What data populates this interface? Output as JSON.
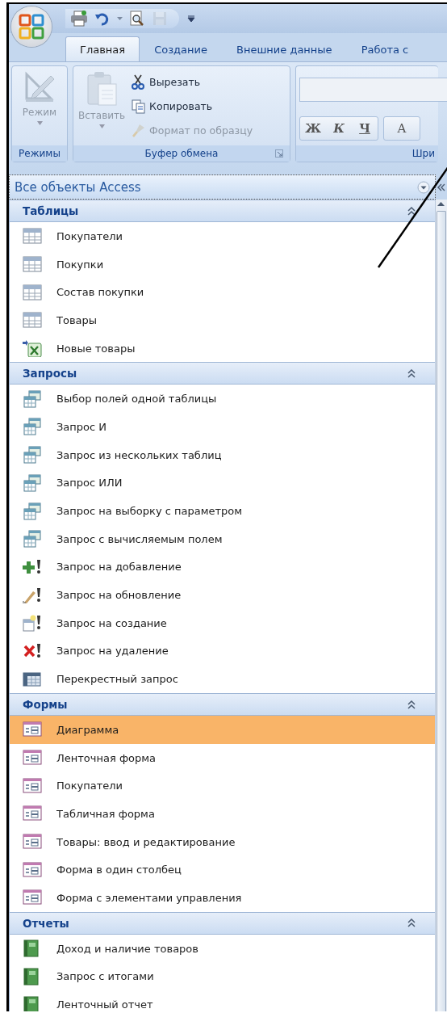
{
  "quick_access": [
    {
      "kind": "print",
      "disabled": false
    },
    {
      "kind": "undo",
      "disabled": false
    },
    {
      "kind": "preview",
      "disabled": false
    },
    {
      "kind": "save",
      "disabled": true
    }
  ],
  "tabs": [
    {
      "label": "Главная",
      "selected": true
    },
    {
      "label": "Создание",
      "selected": false
    },
    {
      "label": "Внешние данные",
      "selected": false
    },
    {
      "label": "Работа с",
      "selected": false
    }
  ],
  "ribbon": {
    "groups": [
      {
        "kind": "modes",
        "label": "Режимы",
        "button": {
          "label": "Режим",
          "disabled": true
        }
      },
      {
        "kind": "clipboard",
        "label": "Буфер обмена",
        "paste": {
          "label": "Вставить",
          "disabled": true
        },
        "commands": [
          {
            "label": "Вырезать",
            "kind": "cut",
            "disabled": false
          },
          {
            "label": "Копировать",
            "kind": "copy",
            "disabled": false
          },
          {
            "label": "Формат по образцу",
            "kind": "brush",
            "disabled": true
          }
        ]
      },
      {
        "kind": "font",
        "label": "Шри",
        "buttons": [
          {
            "label": "Ж",
            "kind": "bold"
          },
          {
            "label": "К",
            "kind": "italic"
          },
          {
            "label": "Ч",
            "kind": "underline"
          },
          {
            "label": "A",
            "kind": "color"
          }
        ]
      }
    ]
  },
  "nav": {
    "title": "Все объекты Access",
    "sections": [
      {
        "title": "Таблицы",
        "expanded": true,
        "items": [
          {
            "label": "Покупатели",
            "kind": "table",
            "selected": false
          },
          {
            "label": "Покупки",
            "kind": "table",
            "selected": false
          },
          {
            "label": "Состав покупки",
            "kind": "table",
            "selected": false
          },
          {
            "label": "Товары",
            "kind": "table",
            "selected": false
          },
          {
            "label": "Новые товары",
            "kind": "linked-excel",
            "selected": false
          }
        ]
      },
      {
        "title": "Запросы",
        "expanded": true,
        "items": [
          {
            "label": "Выбор полей одной таблицы",
            "kind": "select-query",
            "selected": false
          },
          {
            "label": "Запрос И",
            "kind": "select-query",
            "selected": false
          },
          {
            "label": "Запрос из нескольких таблиц",
            "kind": "select-query",
            "selected": false
          },
          {
            "label": "Запрос ИЛИ",
            "kind": "select-query",
            "selected": false
          },
          {
            "label": "Запрос на выборку с параметром",
            "kind": "select-query",
            "selected": false
          },
          {
            "label": "Запрос с вычисляемым полем",
            "kind": "select-query",
            "selected": false
          },
          {
            "label": "Запрос на добавление",
            "kind": "append-query",
            "selected": false
          },
          {
            "label": "Запрос на обновление",
            "kind": "update-query",
            "selected": false
          },
          {
            "label": "Запрос на создание",
            "kind": "make-query",
            "selected": false
          },
          {
            "label": "Запрос на удаление",
            "kind": "delete-query",
            "selected": false
          },
          {
            "label": "Перекрестный запрос",
            "kind": "crosstab-query",
            "selected": false
          }
        ]
      },
      {
        "title": "Формы",
        "expanded": true,
        "items": [
          {
            "label": "Диаграмма",
            "kind": "form",
            "selected": true
          },
          {
            "label": "Ленточная форма",
            "kind": "form",
            "selected": false
          },
          {
            "label": "Покупатели",
            "kind": "form",
            "selected": false
          },
          {
            "label": "Табличная форма",
            "kind": "form",
            "selected": false
          },
          {
            "label": "Товары: ввод и редактирование",
            "kind": "form",
            "selected": false
          },
          {
            "label": "Форма в один столбец",
            "kind": "form",
            "selected": false
          },
          {
            "label": "Форма с элементами управления",
            "kind": "form",
            "selected": false
          }
        ]
      },
      {
        "title": "Отчеты",
        "expanded": true,
        "items": [
          {
            "label": "Доход и наличие товаров",
            "kind": "report",
            "selected": false
          },
          {
            "label": "Запрос с итогами",
            "kind": "report",
            "selected": false
          },
          {
            "label": "Ленточный отчет",
            "kind": "report",
            "selected": false
          }
        ]
      }
    ]
  }
}
